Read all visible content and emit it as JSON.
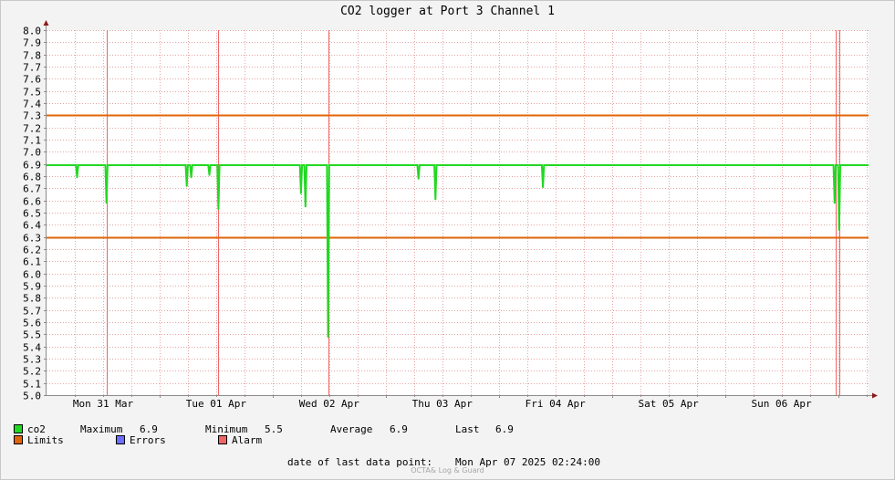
{
  "title": "CO2 logger at Port 3 Channel 1",
  "chart_data": {
    "type": "line",
    "title": "CO2 logger at Port 3 Channel 1",
    "ylim": [
      5.0,
      8.0
    ],
    "y_ticks": [
      "5.0",
      "5.1",
      "5.2",
      "5.3",
      "5.4",
      "5.5",
      "5.6",
      "5.7",
      "5.8",
      "5.9",
      "6.0",
      "6.1",
      "6.2",
      "6.3",
      "6.4",
      "6.5",
      "6.6",
      "6.7",
      "6.8",
      "6.9",
      "7.0",
      "7.1",
      "7.2",
      "7.3",
      "7.4",
      "7.5",
      "7.6",
      "7.7",
      "7.8",
      "7.9",
      "8.0"
    ],
    "x_range_days": [
      0,
      7.27
    ],
    "x_ticks": [
      {
        "day": 0.5,
        "label": "Mon 31 Mar"
      },
      {
        "day": 1.5,
        "label": "Tue 01 Apr"
      },
      {
        "day": 2.5,
        "label": "Wed 02 Apr"
      },
      {
        "day": 3.5,
        "label": "Thu 03 Apr"
      },
      {
        "day": 4.5,
        "label": "Fri 04 Apr"
      },
      {
        "day": 5.5,
        "label": "Sat 05 Apr"
      },
      {
        "day": 6.5,
        "label": "Sun 06 Apr"
      }
    ],
    "grid": true,
    "limits": {
      "upper": 7.3,
      "lower": 6.3,
      "color": "#e0640a"
    },
    "series": [
      {
        "name": "co2",
        "color": "#22d822",
        "baseline": 6.89,
        "dips": [
          {
            "day": 0.27,
            "value": 6.79
          },
          {
            "day": 0.53,
            "value": 6.58
          },
          {
            "day": 1.24,
            "value": 6.72
          },
          {
            "day": 1.28,
            "value": 6.79
          },
          {
            "day": 1.44,
            "value": 6.81
          },
          {
            "day": 1.52,
            "value": 6.53
          },
          {
            "day": 2.25,
            "value": 6.66
          },
          {
            "day": 2.29,
            "value": 6.55
          },
          {
            "day": 2.49,
            "value": 5.48
          },
          {
            "day": 3.29,
            "value": 6.78
          },
          {
            "day": 3.44,
            "value": 6.61
          },
          {
            "day": 4.39,
            "value": 6.71
          },
          {
            "day": 6.97,
            "value": 6.58
          },
          {
            "day": 7.01,
            "value": 6.36
          }
        ]
      }
    ],
    "alarms": [
      0.53,
      1.52,
      2.49,
      6.98,
      7.01
    ],
    "legend": [
      {
        "name": "co2",
        "color": "#22d822"
      },
      {
        "name": "Limits",
        "color": "#e0640a"
      },
      {
        "name": "Errors",
        "color": "#6e6eff"
      },
      {
        "name": "Alarm",
        "color": "#ee6666"
      }
    ]
  },
  "stats": {
    "maximum_label": "Maximum",
    "maximum": "6.9",
    "minimum_label": "Minimum",
    "minimum": "5.5",
    "average_label": "Average",
    "average": "6.9",
    "last_label": "Last",
    "last": "6.9"
  },
  "last_point": {
    "label": "date of last data point:",
    "value": "Mon Apr 07 2025 02:24:00"
  },
  "footer_note": "OCTA& Log & Guard"
}
